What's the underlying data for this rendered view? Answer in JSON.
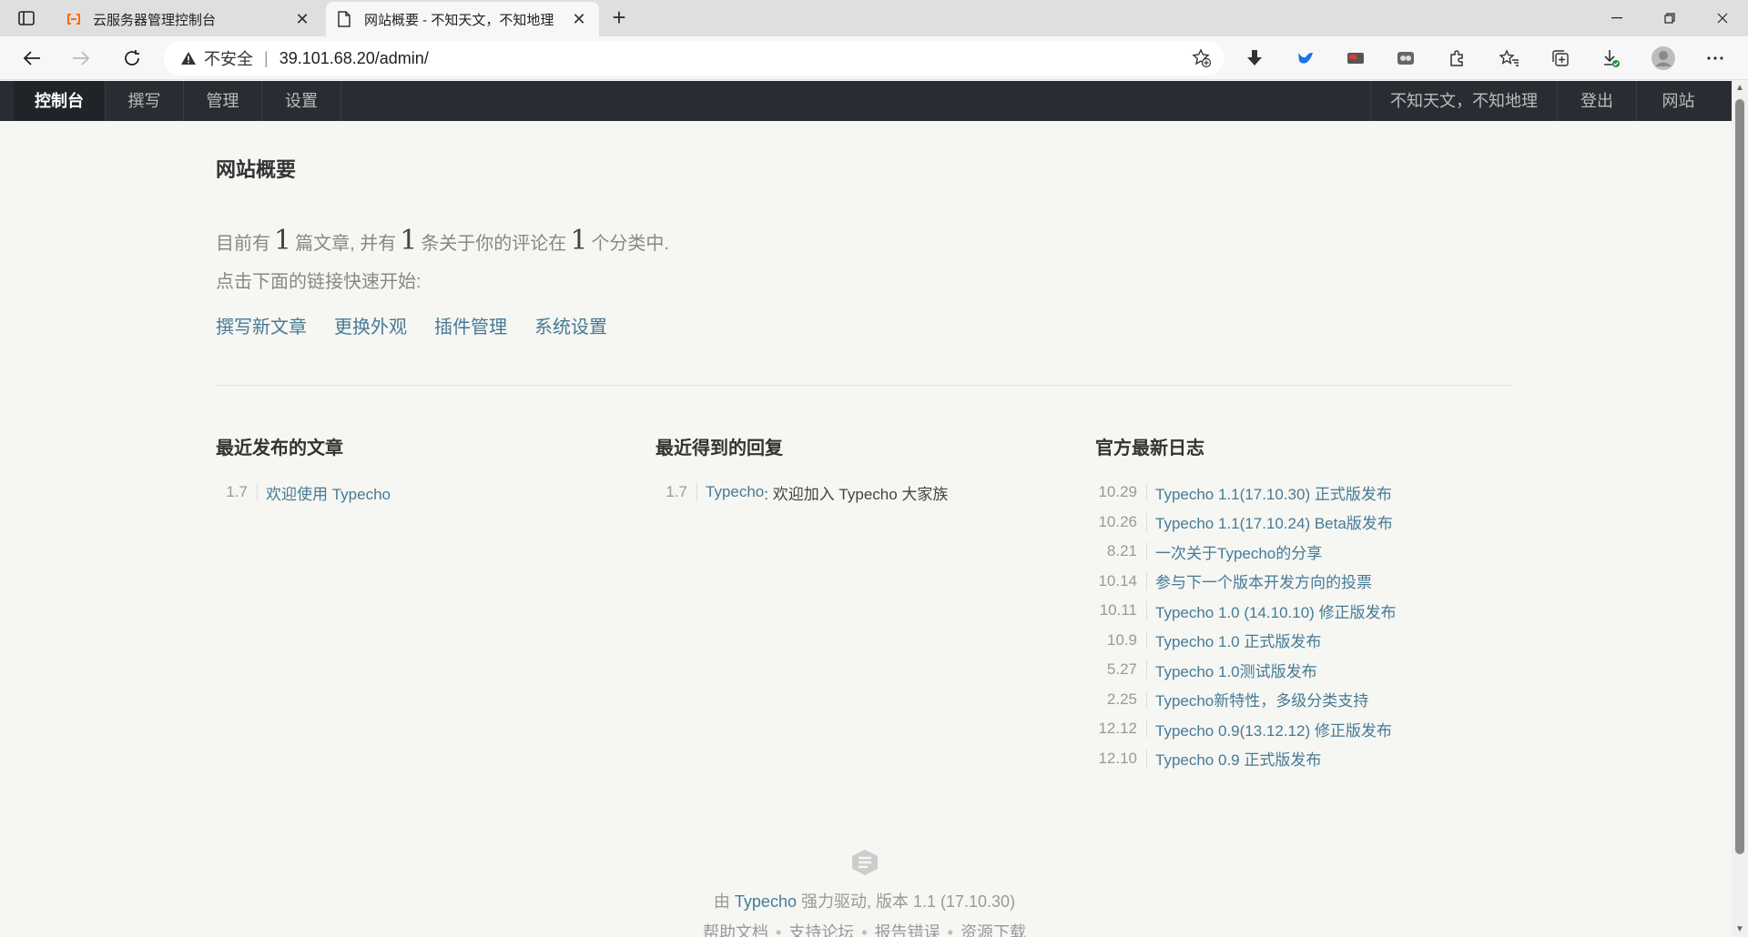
{
  "browser": {
    "tabs": [
      {
        "title": "云服务器管理控制台",
        "active": false
      },
      {
        "title": "网站概要 - 不知天文，不知地理",
        "active": true
      }
    ],
    "address": {
      "security": "不安全",
      "separator": "|",
      "url": "39.101.68.20/admin/"
    }
  },
  "admin_nav": {
    "left": [
      "控制台",
      "撰写",
      "管理",
      "设置"
    ],
    "right": [
      "不知天文，不知地理",
      "登出",
      "网站"
    ]
  },
  "page": {
    "title": "网站概要",
    "summary": {
      "p1": "目前有",
      "posts": "1",
      "p2": "篇文章, 并有",
      "comments": "1",
      "p3": "条关于你的评论在",
      "categories": "1",
      "p4": "个分类中."
    },
    "quickstart": "点击下面的链接快速开始:",
    "quicklinks": [
      "撰写新文章",
      "更换外观",
      "插件管理",
      "系统设置"
    ]
  },
  "recent_posts": {
    "heading": "最近发布的文章",
    "items": [
      {
        "date": "1.7",
        "title": "欢迎使用 Typecho"
      }
    ]
  },
  "recent_replies": {
    "heading": "最近得到的回复",
    "items": [
      {
        "date": "1.7",
        "author": "Typecho",
        "text": ": 欢迎加入 Typecho 大家族"
      }
    ]
  },
  "official_log": {
    "heading": "官方最新日志",
    "items": [
      {
        "date": "10.29",
        "title": "Typecho 1.1(17.10.30) 正式版发布"
      },
      {
        "date": "10.26",
        "title": "Typecho 1.1(17.10.24) Beta版发布"
      },
      {
        "date": "8.21",
        "title": "一次关于Typecho的分享"
      },
      {
        "date": "10.14",
        "title": "参与下一个版本开发方向的投票"
      },
      {
        "date": "10.11",
        "title": "Typecho 1.0 (14.10.10) 修正版发布"
      },
      {
        "date": "10.9",
        "title": "Typecho 1.0 正式版发布"
      },
      {
        "date": "5.27",
        "title": "Typecho 1.0测试版发布"
      },
      {
        "date": "2.25",
        "title": "Typecho新特性，多级分类支持"
      },
      {
        "date": "12.12",
        "title": "Typecho 0.9(13.12.12) 修正版发布"
      },
      {
        "date": "12.10",
        "title": "Typecho 0.9 正式版发布"
      }
    ]
  },
  "footer": {
    "by": "由",
    "brand": "Typecho",
    "powered": "强力驱动, 版本 1.1 (17.10.30)",
    "links": [
      "帮助文档",
      "支持论坛",
      "报告错误",
      "资源下载"
    ]
  },
  "colors": {
    "nav_bg": "#292d33",
    "link": "#467b96",
    "page_bg": "#f6f6f3"
  }
}
